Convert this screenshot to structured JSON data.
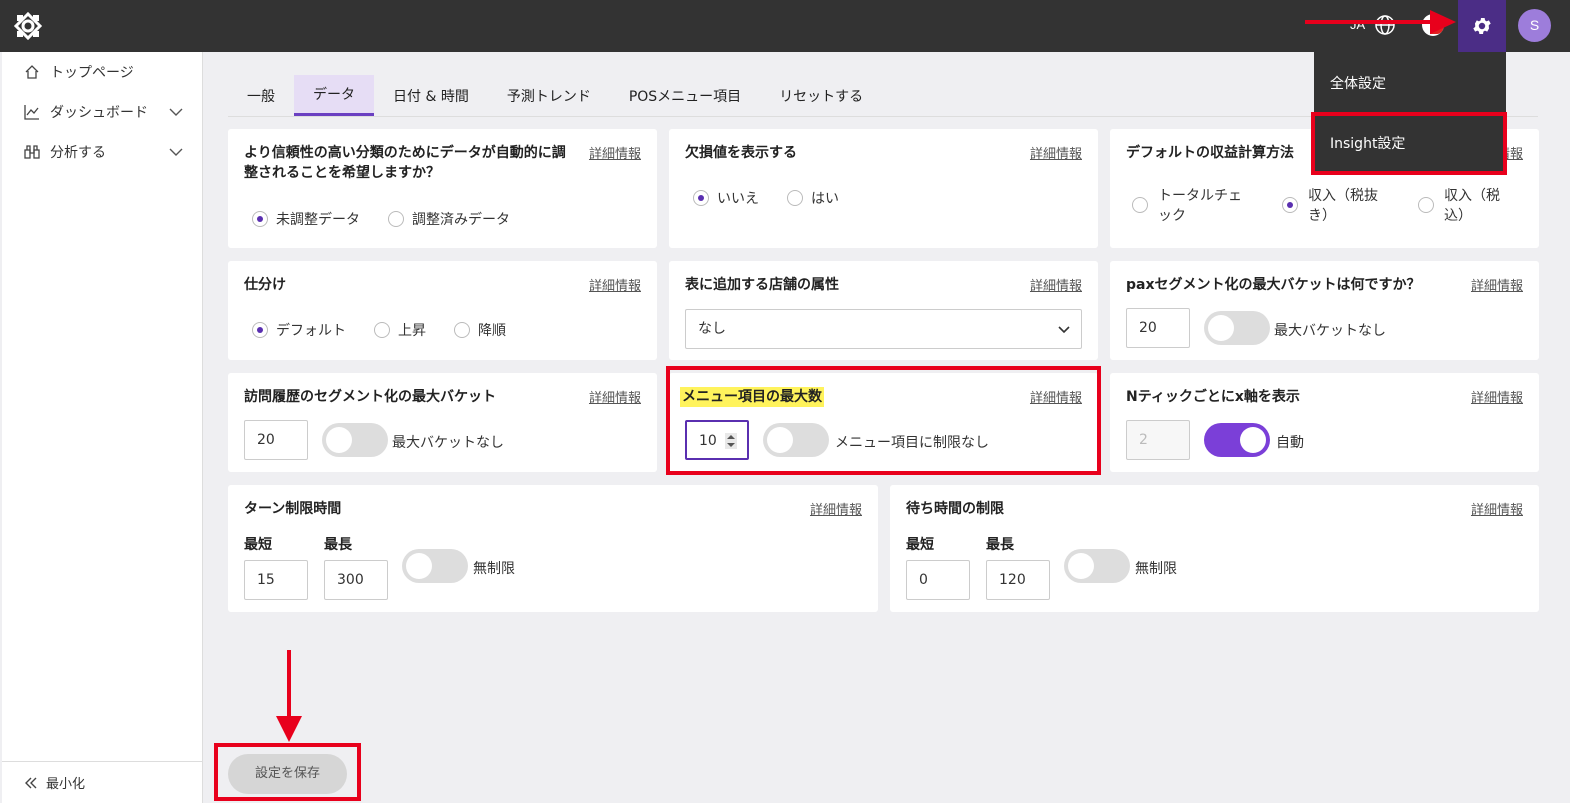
{
  "header": {
    "lang": "JA",
    "avatar_letter": "S"
  },
  "settings_menu": {
    "items": [
      "全体設定",
      "Insight設定"
    ]
  },
  "sidebar": {
    "items": [
      {
        "label": "トップページ",
        "icon": "home-icon"
      },
      {
        "label": "ダッシュボード",
        "icon": "chart-icon"
      },
      {
        "label": "分析する",
        "icon": "binoculars-icon"
      }
    ],
    "minimize_label": "最小化"
  },
  "tabs": [
    "一般",
    "データ",
    "日付 & 時間",
    "予測トレンド",
    "POSメニュー項目",
    "リセットする"
  ],
  "active_tab": "データ",
  "more_info": "詳細情報",
  "cards": {
    "adjusted": {
      "title_line1": "より信頼性の高い分類のためにデータが自動的に調",
      "title_line2": "整されることを希望しますか？",
      "options": [
        "未調整データ",
        "調整済みデータ"
      ]
    },
    "missing": {
      "title": "欠損値を表示する",
      "options": [
        "いいえ",
        "はい"
      ]
    },
    "revenue": {
      "title": "デフォルトの収益計算方法",
      "options": [
        {
          "line1": "トータルチェ",
          "line2": "ック"
        },
        {
          "line1": "収入（税抜",
          "line2": "き）"
        },
        {
          "line1": "収入（税",
          "line2": "込）"
        }
      ]
    },
    "sort": {
      "title": "仕分け",
      "options": [
        "デフォルト",
        "上昇",
        "降順"
      ]
    },
    "store_attr": {
      "title": "表に追加する店舗の属性",
      "selected": "なし"
    },
    "pax": {
      "title": "paxセグメント化の最大バケットは何ですか？",
      "value": "20",
      "toggle_label": "最大バケットなし"
    },
    "visit_history": {
      "title": "訪問履歴のセグメント化の最大バケット",
      "value": "20",
      "toggle_label": "最大バケットなし"
    },
    "menu_max": {
      "title": "メニュー項目の最大数",
      "value": "10",
      "toggle_label": "メニュー項目に制限なし"
    },
    "xaxis": {
      "title": "Nティックごとにx軸を表示",
      "value": "2",
      "toggle_label": "自動"
    },
    "turn_limit": {
      "title": "ターン制限時間",
      "min_label": "最短",
      "max_label": "最長",
      "min_value": "15",
      "max_value": "300",
      "toggle_label": "無制限"
    },
    "wait_limit": {
      "title": "待ち時間の制限",
      "min_label": "最短",
      "max_label": "最長",
      "min_value": "0",
      "max_value": "120",
      "toggle_label": "無制限"
    }
  },
  "save_button": "設定を保存",
  "colors": {
    "accent": "#6a3fc1",
    "annotation_red": "#e8001c",
    "highlight_yellow": "#fff35c"
  }
}
